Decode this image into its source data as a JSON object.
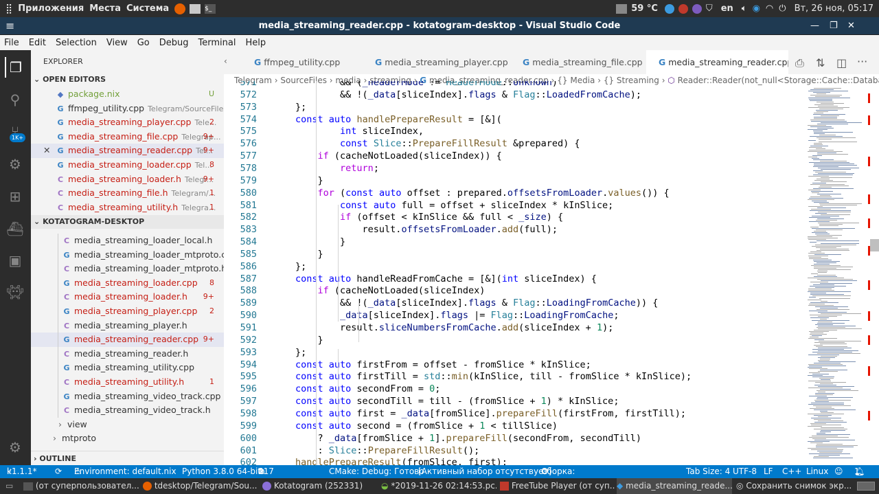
{
  "system_bar": {
    "apps": "Приложения",
    "places": "Места",
    "system": "Система",
    "temp": "59 °C",
    "lang": "en",
    "datetime": "Вт, 26 ноя, 05:17"
  },
  "title": "media_streaming_reader.cpp - kotatogram-desktop - Visual Studio Code",
  "menu": [
    "File",
    "Edit",
    "Selection",
    "View",
    "Go",
    "Debug",
    "Terminal",
    "Help"
  ],
  "activity_badge": "1K+",
  "explorer": {
    "title": "EXPLORER",
    "open_editors_label": "OPEN EDITORS",
    "open_editors": [
      {
        "name": "package.nix",
        "dir": "",
        "badge": "U",
        "red": false,
        "type": "nix",
        "close": false
      },
      {
        "name": "ffmpeg_utility.cpp",
        "dir": "Telegram/SourceFiles...",
        "badge": "",
        "red": false,
        "type": "cpp",
        "close": false
      },
      {
        "name": "media_streaming_player.cpp",
        "dir": "Tele...",
        "badge": "2",
        "red": true,
        "type": "cpp",
        "close": false
      },
      {
        "name": "media_streaming_file.cpp",
        "dir": "Telegrap...",
        "badge": "9+",
        "red": true,
        "type": "cpp",
        "close": false
      },
      {
        "name": "media_streaming_reader.cpp",
        "dir": "Tel...",
        "badge": "9+",
        "red": true,
        "type": "cpp",
        "close": true
      },
      {
        "name": "media_streaming_loader.cpp",
        "dir": "Tel...",
        "badge": "8",
        "red": true,
        "type": "cpp",
        "close": false
      },
      {
        "name": "media_streaming_loader.h",
        "dir": "Telegr...",
        "badge": "9+",
        "red": true,
        "type": "h",
        "close": false
      },
      {
        "name": "media_streaming_file.h",
        "dir": "Telegram/...",
        "badge": "1",
        "red": true,
        "type": "h",
        "close": false
      },
      {
        "name": "media_streaming_utility.h",
        "dir": "Telegra...",
        "badge": "1",
        "red": true,
        "type": "h",
        "close": false
      }
    ],
    "project_label": "KOTATOGRAM-DESKTOP",
    "files": [
      {
        "name": "media_streaming_loader_local.h",
        "badge": "",
        "red": false,
        "type": "h"
      },
      {
        "name": "media_streaming_loader_mtproto.cpp",
        "badge": "",
        "red": false,
        "type": "cpp"
      },
      {
        "name": "media_streaming_loader_mtproto.h",
        "badge": "",
        "red": false,
        "type": "h"
      },
      {
        "name": "media_streaming_loader.cpp",
        "badge": "8",
        "red": true,
        "type": "cpp"
      },
      {
        "name": "media_streaming_loader.h",
        "badge": "9+",
        "red": true,
        "type": "h"
      },
      {
        "name": "media_streaming_player.cpp",
        "badge": "2",
        "red": true,
        "type": "cpp"
      },
      {
        "name": "media_streaming_player.h",
        "badge": "",
        "red": false,
        "type": "h"
      },
      {
        "name": "media_streaming_reader.cpp",
        "badge": "9+",
        "red": true,
        "type": "cpp",
        "selected": true
      },
      {
        "name": "media_streaming_reader.h",
        "badge": "",
        "red": false,
        "type": "h"
      },
      {
        "name": "media_streaming_utility.cpp",
        "badge": "",
        "red": false,
        "type": "cpp"
      },
      {
        "name": "media_streaming_utility.h",
        "badge": "1",
        "red": true,
        "type": "h"
      },
      {
        "name": "media_streaming_video_track.cpp",
        "badge": "",
        "red": false,
        "type": "cpp"
      },
      {
        "name": "media_streaming_video_track.h",
        "badge": "",
        "red": false,
        "type": "h"
      }
    ],
    "folders": [
      "view",
      "mtproto"
    ],
    "outline_label": "OUTLINE"
  },
  "tabs": [
    "ffmpeg_utility.cpp",
    "media_streaming_player.cpp",
    "media_streaming_file.cpp",
    "media_streaming_reader.cpp"
  ],
  "breadcrumb": [
    "Telegram",
    "SourceFiles",
    "media",
    "streaming",
    "media_streaming_reader.cpp",
    "{} Media",
    "{} Streaming",
    "Reader::Reader(not_null<Storage::Cache::Database*>"
  ],
  "code": [
    {
      "n": "571",
      "t": "        && (_headerMode != HeaderMode::Unknown)"
    },
    {
      "n": "572",
      "t": "        && !(_data[sliceIndex].flags & Flag::LoadedFromCache);"
    },
    {
      "n": "573",
      "t": "};"
    },
    {
      "n": "574",
      "t": "const auto handlePrepareResult = [&]("
    },
    {
      "n": "575",
      "t": "        int sliceIndex,"
    },
    {
      "n": "576",
      "t": "        const Slice::PrepareFillResult &prepared) {"
    },
    {
      "n": "577",
      "t": "    if (cacheNotLoaded(sliceIndex)) {"
    },
    {
      "n": "578",
      "t": "        return;"
    },
    {
      "n": "579",
      "t": "    }"
    },
    {
      "n": "580",
      "t": "    for (const auto offset : prepared.offsetsFromLoader.values()) {"
    },
    {
      "n": "581",
      "t": "        const auto full = offset + sliceIndex * kInSlice;"
    },
    {
      "n": "582",
      "t": "        if (offset < kInSlice && full < _size) {"
    },
    {
      "n": "583",
      "t": "            result.offsetsFromLoader.add(full);"
    },
    {
      "n": "584",
      "t": "        }"
    },
    {
      "n": "585",
      "t": "    }"
    },
    {
      "n": "586",
      "t": "};"
    },
    {
      "n": "587",
      "t": "const auto handleReadFromCache = [&](int sliceIndex) {"
    },
    {
      "n": "588",
      "t": "    if (cacheNotLoaded(sliceIndex)"
    },
    {
      "n": "589",
      "t": "        && !(_data[sliceIndex].flags & Flag::LoadingFromCache)) {"
    },
    {
      "n": "590",
      "t": "        _data[sliceIndex].flags |= Flag::LoadingFromCache;"
    },
    {
      "n": "591",
      "t": "        result.sliceNumbersFromCache.add(sliceIndex + 1);"
    },
    {
      "n": "592",
      "t": "    }"
    },
    {
      "n": "593",
      "t": "};"
    },
    {
      "n": "594",
      "t": "const auto firstFrom = offset - fromSlice * kInSlice;"
    },
    {
      "n": "595",
      "t": "const auto firstTill = std::min(kInSlice, till - fromSlice * kInSlice);"
    },
    {
      "n": "596",
      "t": "const auto secondFrom = 0;"
    },
    {
      "n": "597",
      "t": "const auto secondTill = till - (fromSlice + 1) * kInSlice;"
    },
    {
      "n": "598",
      "t": "const auto first = _data[fromSlice].prepareFill(firstFrom, firstTill);"
    },
    {
      "n": "599",
      "t": "const auto second = (fromSlice + 1 < tillSlice)"
    },
    {
      "n": "600",
      "t": "    ? _data[fromSlice + 1].prepareFill(secondFrom, secondTill)"
    },
    {
      "n": "601",
      "t": "    : Slice::PrepareFillResult();"
    },
    {
      "n": "602",
      "t": "handlePrepareResult(fromSlice, first);"
    }
  ],
  "status": {
    "branch": "k1.1.1*",
    "env": "Environment: default.nix",
    "python": "Python 3.8.0 64-bit",
    "errors": "117",
    "warnings": "0",
    "cmake": "CMake: Debug: Готово",
    "kit": "[Активный набор отсутствует]",
    "build": "Сборка:",
    "tabsize": "Tab Size: 4",
    "encoding": "UTF-8",
    "eol": "LF",
    "lang": "C++",
    "os": "Linux",
    "bell": "1"
  },
  "taskbar": [
    "(от суперпользовател...",
    "tdesktop/Telegram/Sou...",
    "Kotatogram (252331)",
    "*2019-11-26 02:14:53.pc...",
    "FreeTube Player (от суп...",
    "media_streaming_reade...",
    "Сохранить снимок экр..."
  ]
}
